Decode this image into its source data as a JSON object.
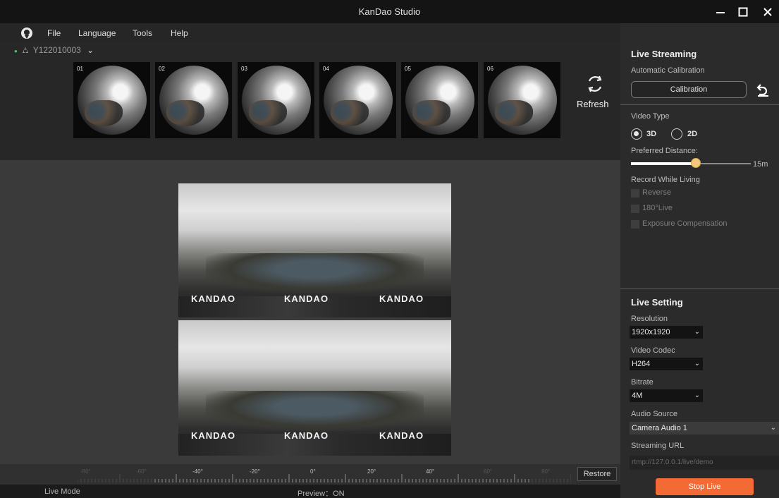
{
  "window": {
    "title": "KanDao Studio"
  },
  "menu": {
    "items": [
      "File",
      "Language",
      "Tools",
      "Help"
    ]
  },
  "device": {
    "id": "Y122010003"
  },
  "thumbnails": [
    "01",
    "02",
    "03",
    "04",
    "05",
    "06"
  ],
  "refresh_label": "Refresh",
  "panorama": {
    "watermark": "KANDAO"
  },
  "ruler": {
    "labels": [
      "-80°",
      "-60°",
      "-40°",
      "-20°",
      "0°",
      "20°",
      "40°",
      "60°",
      "80°"
    ],
    "restore_label": "Restore"
  },
  "status": {
    "mode": "Live Mode",
    "preview": "Preview：ON"
  },
  "live_streaming": {
    "title": "Live Streaming",
    "auto_calibration_label": "Automatic Calibration",
    "calibration_button": "Calibration",
    "video_type_label": "Video Type",
    "video_type_options": [
      "3D",
      "2D"
    ],
    "video_type_selected": "3D",
    "preferred_distance_label": "Preferred Distance:",
    "preferred_distance_value": "15m",
    "preferred_distance_level": 0.54,
    "record_while_living_label": "Record While Living",
    "options": [
      "Reverse",
      "180°Live",
      "Exposure Compensation"
    ]
  },
  "live_setting": {
    "title": "Live Setting",
    "resolution_label": "Resolution",
    "resolution_value": "1920x1920",
    "codec_label": "Video Codec",
    "codec_value": "H264",
    "bitrate_label": "Bitrate",
    "bitrate_value": "4M",
    "audio_label": "Audio Source",
    "audio_value": "Camera Audio 1",
    "url_label": "Streaming URL",
    "url_placeholder": "rtmp://127.0.0.1/live/demo",
    "stop_button": "Stop Live"
  }
}
